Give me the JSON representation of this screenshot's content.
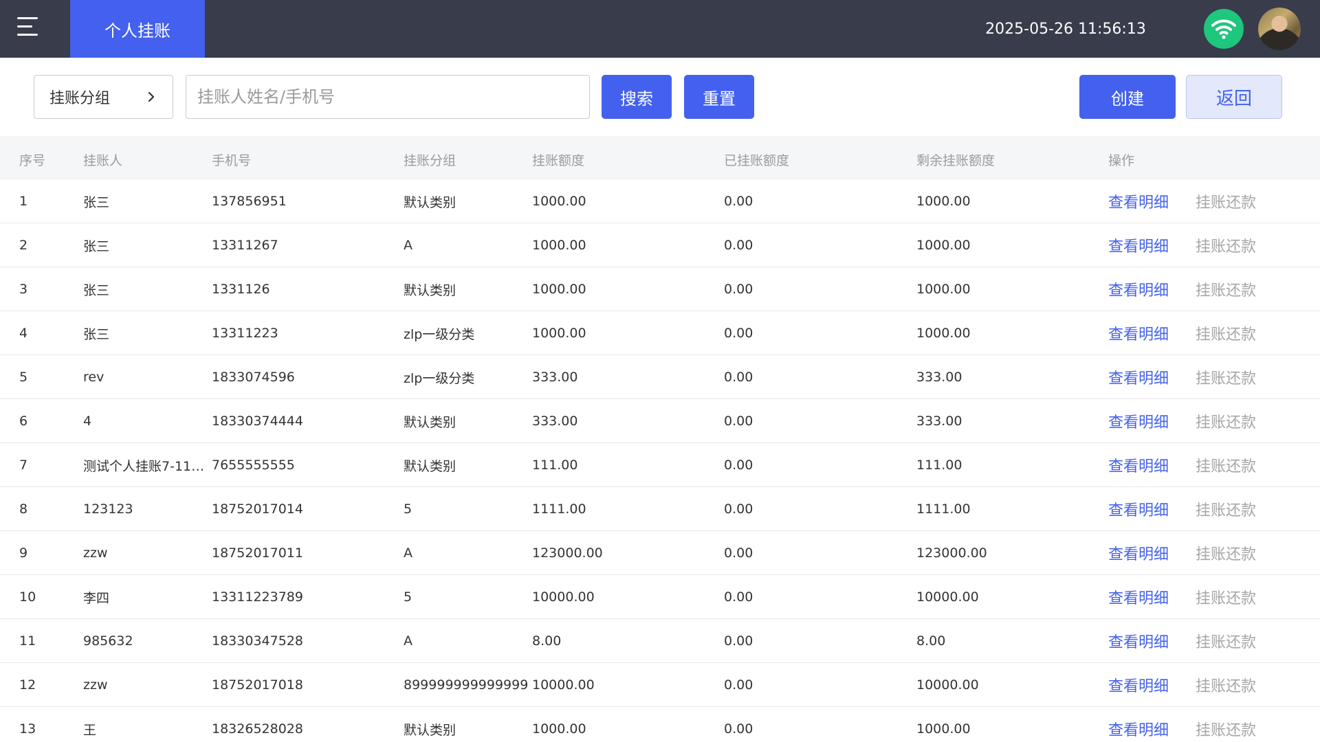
{
  "header": {
    "active_tab": "个人挂账",
    "datetime": "2025-05-26 11:56:13"
  },
  "filters": {
    "group_label": "挂账分组",
    "search_placeholder": "挂账人姓名/手机号",
    "search_button": "搜索",
    "reset_button": "重置",
    "create_button": "创建",
    "back_button": "返回"
  },
  "table": {
    "columns": [
      "序号",
      "挂账人",
      "手机号",
      "挂账分组",
      "挂账额度",
      "已挂账额度",
      "剩余挂账额度",
      "操作"
    ],
    "action_view": "查看明细",
    "action_repay": "挂账还款",
    "rows": [
      [
        "1",
        "张三",
        "137856951",
        "默认类别",
        "1000.00",
        "0.00",
        "1000.00"
      ],
      [
        "2",
        "张三",
        "13311267",
        "A",
        "1000.00",
        "0.00",
        "1000.00"
      ],
      [
        "3",
        "张三",
        "1331126",
        "默认类别",
        "1000.00",
        "0.00",
        "1000.00"
      ],
      [
        "4",
        "张三",
        "13311223",
        "zlp一级分类",
        "1000.00",
        "0.00",
        "1000.00"
      ],
      [
        "5",
        "rev",
        "1833074596",
        "zlp一级分类",
        "333.00",
        "0.00",
        "333.00"
      ],
      [
        "6",
        "4",
        "18330374444",
        "默认类别",
        "333.00",
        "0.00",
        "333.00"
      ],
      [
        "7",
        "测试个人挂账7-11…",
        "7655555555",
        "默认类别",
        "111.00",
        "0.00",
        "111.00"
      ],
      [
        "8",
        "123123",
        "18752017014",
        "5",
        "1111.00",
        "0.00",
        "1111.00"
      ],
      [
        "9",
        "zzw",
        "18752017011",
        "A",
        "123000.00",
        "0.00",
        "123000.00"
      ],
      [
        "10",
        "李四",
        "13311223789",
        "5",
        "10000.00",
        "0.00",
        "10000.00"
      ],
      [
        "11",
        "985632",
        "18330347528",
        "A",
        "8.00",
        "0.00",
        "8.00"
      ],
      [
        "12",
        "zzw",
        "18752017018",
        "899999999999999…",
        "10000.00",
        "0.00",
        "10000.00"
      ],
      [
        "13",
        "王",
        "18326528028",
        "默认类别",
        "1000.00",
        "0.00",
        "1000.00"
      ]
    ]
  }
}
